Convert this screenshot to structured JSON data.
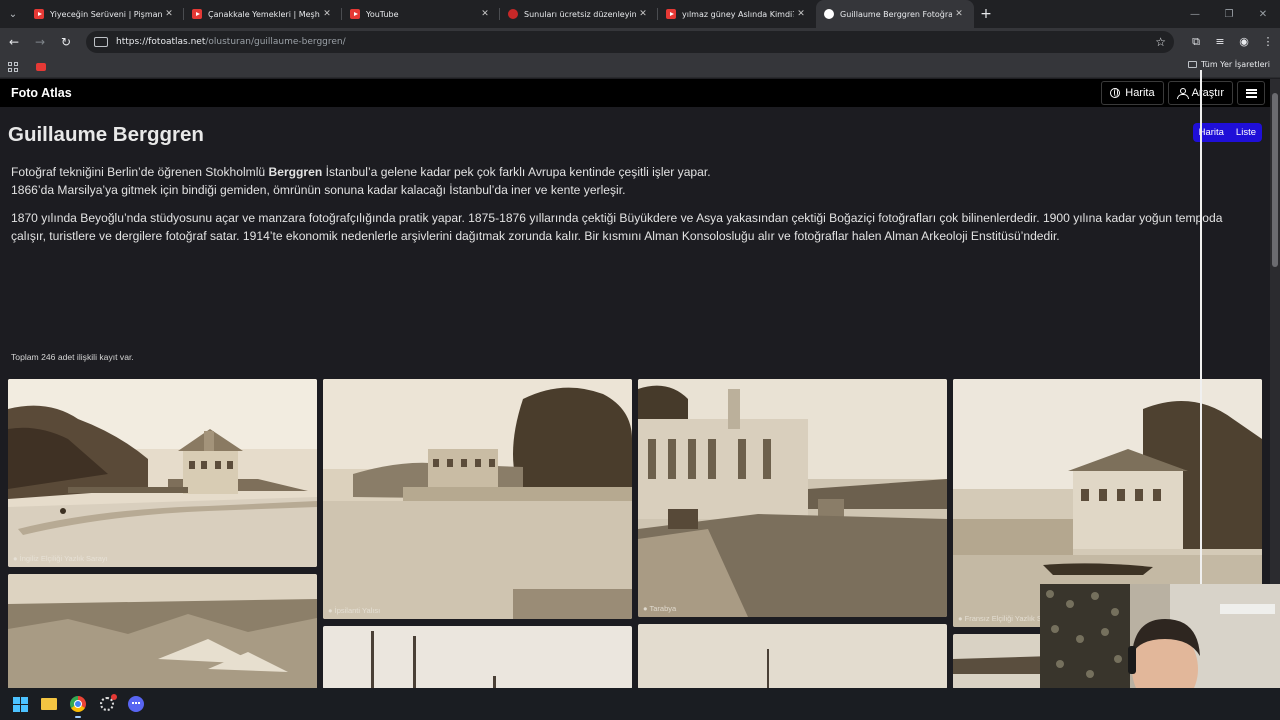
{
  "browser": {
    "tabs": [
      {
        "title": "Yiyeceğin Serüveni | Pişmaniye...",
        "icon": "youtube-icon",
        "active": false
      },
      {
        "title": "Çanakkale Yemekleri | Meşhur Y...",
        "icon": "youtube-icon",
        "active": false
      },
      {
        "title": "YouTube",
        "icon": "youtube-icon",
        "active": false
      },
      {
        "title": "Sunuları ücretsiz düzenleyin | W...",
        "icon": "slides-icon",
        "active": false
      },
      {
        "title": "yılmaz güney Aslında Kimdi? | Y...",
        "icon": "youtube-icon",
        "active": false
      },
      {
        "title": "Guillaume Berggren Fotoğrafları...",
        "icon": "globe-icon",
        "active": true
      }
    ],
    "url_host": "https://fotoatlas.net",
    "url_path": "/olusturan/guillaume-berggren/",
    "bookmarks_all": "Tüm Yer İşaretleri"
  },
  "site": {
    "brand": "Foto Atlas",
    "nav": {
      "map": "Harita",
      "explore": "Araştır"
    },
    "title": "Guillaume Berggren",
    "view_toggle": {
      "map": "Harita",
      "list": "Liste"
    },
    "bio": {
      "p1_before": "Fotoğraf tekniğini Berlin’de öğrenen Stokholmlü ",
      "p1_bold": "Berggren",
      "p1_after": " İstanbul’a gelene kadar pek çok farklı Avrupa kentinde çeşitli işler yapar.",
      "p1_line2": "1866’da Marsilya’ya gitmek için bindiği gemiden, ömrünün sonuna kadar kalacağı İstanbul’da iner ve kente yerleşir.",
      "p2": "1870 yılında Beyoğlu’nda stüdyosunu açar ve manzara fotoğrafçılığında pratik yapar. 1875-1876 yıllarında çektiği Büyükdere ve Asya yakasından çektiği Boğaziçi fotoğrafları çok bilinenlerdedir. 1900 yılına kadar yoğun tempoda çalışır, turistlere ve dergilere fotoğraf satar. 1914’te ekonomik nedenlerle arşivlerini dağıtmak zorunda kalır. Bir kısmını Alman Konsolosluğu alır ve fotoğraflar halen Alman Arkeoloji Enstitüsü’ndedir."
    },
    "record_count": "Toplam 246 adet ilişkili kayıt var.",
    "photos": [
      {
        "caption": "● İngiliz Elçiliği Yazlık Sarayı"
      },
      {
        "caption": "● İpsilanti Yalısı"
      },
      {
        "caption": "● Tarabya"
      },
      {
        "caption": "● Fransız Elçiliği Yazlık Sarayı"
      }
    ]
  }
}
